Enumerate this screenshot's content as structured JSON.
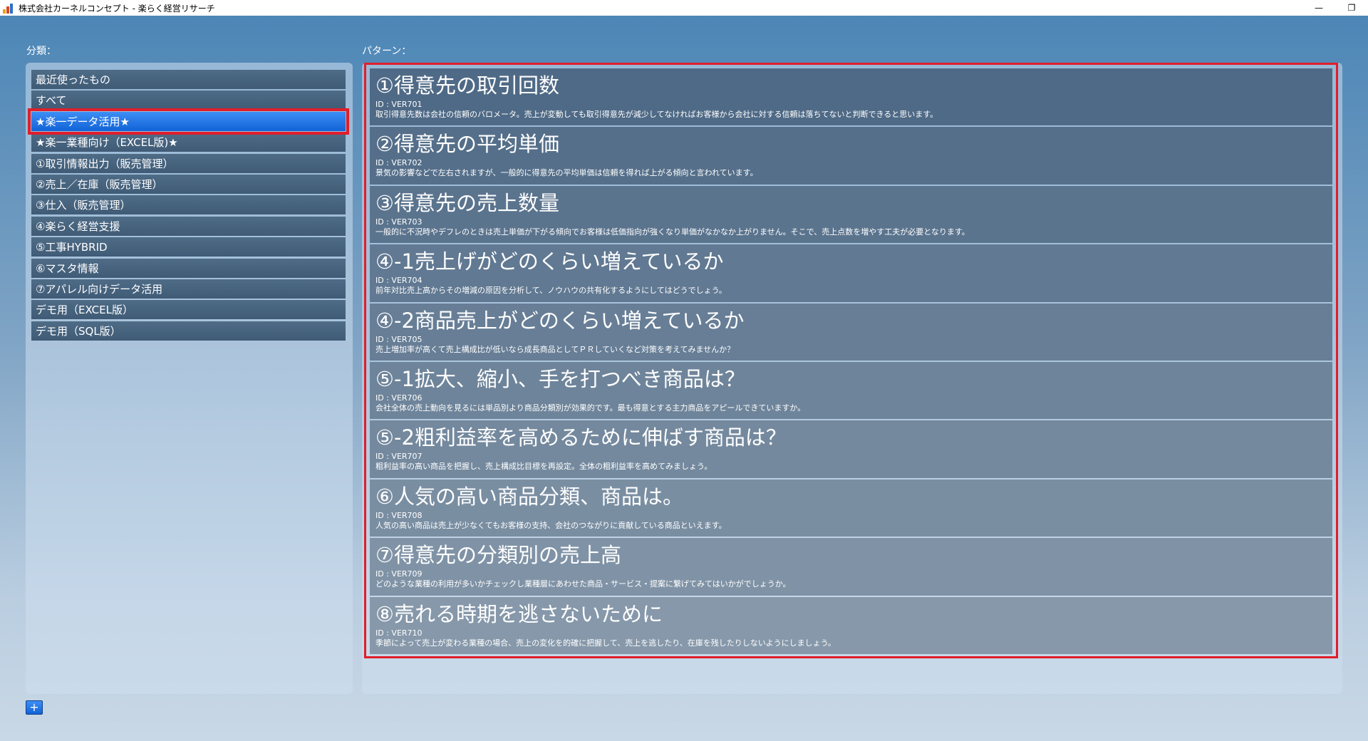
{
  "window": {
    "title": "株式会社カーネルコンセプト - 楽らく経営リサーチ",
    "minimize": "—",
    "restore": "❐",
    "close": "✕"
  },
  "colors": {
    "accent_red": "#e01e2b",
    "selected_blue": "#1163d6",
    "item_dark": "#3f5b76"
  },
  "sidebar": {
    "label": "分類：",
    "items": [
      {
        "label": "最近使ったもの"
      },
      {
        "label": "すべて"
      },
      {
        "label": "★楽一データ活用★"
      },
      {
        "label": "★楽一業種向け（EXCEL版)★"
      },
      {
        "label": "①取引情報出力（販売管理）"
      },
      {
        "label": "②売上／在庫（販売管理）"
      },
      {
        "label": "③仕入（販売管理）"
      },
      {
        "label": "④楽らく経営支援"
      },
      {
        "label": "⑤工事HYBRID"
      },
      {
        "label": "⑥マスタ情報"
      },
      {
        "label": "⑦アパレル向けデータ活用"
      },
      {
        "label": "デモ用（EXCEL版）"
      },
      {
        "label": "デモ用（SQL版）"
      }
    ],
    "selected_index": 2
  },
  "main": {
    "label": "パターン：",
    "patterns": [
      {
        "title": "①得意先の取引回数",
        "id": "ID : VER701",
        "desc": "取引得意先数は会社の信頼のバロメータ。売上が変動しても取引得意先が減少してなければお客様から会社に対する信頼は落ちてないと判断できると思います。"
      },
      {
        "title": "②得意先の平均単価",
        "id": "ID : VER702",
        "desc": "景気の影響などで左右されますが、一般的に得意先の平均単価は信頼を得れば上がる傾向と言われています。"
      },
      {
        "title": "③得意先の売上数量",
        "id": "ID : VER703",
        "desc": "一般的に不況時やデフレのときは売上単価が下がる傾向でお客様は低価指向が強くなり単価がなかなか上がりません。そこで、売上点数を増やす工夫が必要となります。"
      },
      {
        "title": "④-1売上げがどのくらい増えているか",
        "id": "ID : VER704",
        "desc": "前年対比売上高からその増減の原因を分析して、ノウハウの共有化するようにしてはどうでしょう。"
      },
      {
        "title": "④-2商品売上がどのくらい増えているか",
        "id": "ID : VER705",
        "desc": "売上増加率が高くて売上構成比が低いなら成長商品としてＰＲしていくなど対策を考えてみませんか？"
      },
      {
        "title": "⑤-1拡大、縮小、手を打つべき商品は？",
        "id": "ID : VER706",
        "desc": "会社全体の売上動向を見るには単品別より商品分類別が効果的です。最も得意とする主力商品をアピールできていますか。"
      },
      {
        "title": "⑤-2粗利益率を高めるために伸ばす商品は？",
        "id": "ID : VER707",
        "desc": "粗利益率の高い商品を把握し、売上構成比目標を再設定。全体の粗利益率を高めてみましょう。"
      },
      {
        "title": "⑥人気の高い商品分類、商品は。",
        "id": "ID : VER708",
        "desc": "人気の高い商品は売上が少なくてもお客様の支持、会社のつながりに貢献している商品といえます。"
      },
      {
        "title": "⑦得意先の分類別の売上高",
        "id": "ID : VER709",
        "desc": "どのような業種の利用が多いかチェックし業種層にあわせた商品・サービス・提案に繋げてみてはいかがでしょうか。"
      },
      {
        "title": "⑧売れる時期を逃さないために",
        "id": "ID : VER710",
        "desc": "季節によって売上が変わる業種の場合、売上の変化を的確に把握して、売上を逃したり、在庫を残したりしないようにしましょう。"
      }
    ]
  },
  "add_button": {
    "label": "+"
  }
}
